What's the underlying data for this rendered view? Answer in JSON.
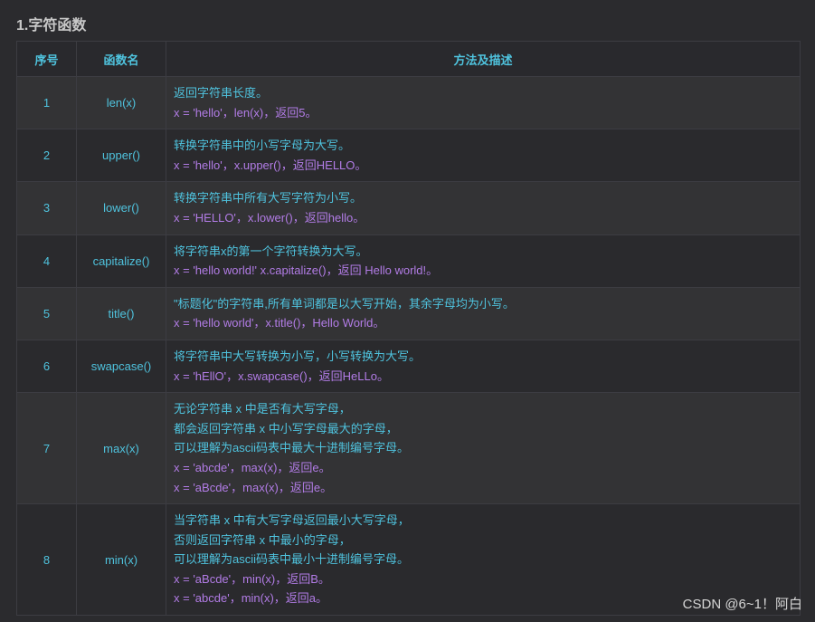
{
  "heading": "1.字符函数",
  "headers": {
    "num": "序号",
    "name": "函数名",
    "desc": "方法及描述"
  },
  "rows": [
    {
      "num": "1",
      "name": "len(x)",
      "lines": [
        "返回字符串长度。"
      ],
      "examples": [
        "x = 'hello'，len(x)，返回5。"
      ]
    },
    {
      "num": "2",
      "name": "upper()",
      "lines": [
        "转换字符串中的小写字母为大写。"
      ],
      "examples": [
        "x = 'hello'，x.upper()，返回HELLO。"
      ]
    },
    {
      "num": "3",
      "name": "lower()",
      "lines": [
        "转换字符串中所有大写字符为小写。"
      ],
      "examples": [
        "x = 'HELLO'，x.lower()，返回hello。"
      ]
    },
    {
      "num": "4",
      "name": "capitalize()",
      "lines": [
        "将字符串x的第一个字符转换为大写。"
      ],
      "examples": [
        "x = 'hello world!' x.capitalize()，返回 Hello world!。"
      ]
    },
    {
      "num": "5",
      "name": "title()",
      "lines": [
        "\"标题化\"的字符串,所有单词都是以大写开始，其余字母均为小写。"
      ],
      "examples": [
        "x = 'hello world'，x.title()，Hello World。"
      ]
    },
    {
      "num": "6",
      "name": "swapcase()",
      "lines": [
        "将字符串中大写转换为小写，小写转换为大写。"
      ],
      "examples": [
        "x = 'hEllO'，x.swapcase()，返回HeLLo。"
      ]
    },
    {
      "num": "7",
      "name": "max(x)",
      "lines": [
        "无论字符串 x 中是否有大写字母，",
        "都会返回字符串 x 中小写字母最大的字母，",
        "可以理解为ascii码表中最大十进制编号字母。"
      ],
      "examples": [
        "x = 'abcde'，max(x)，返回e。",
        "x = 'aBcde'，max(x)，返回e。"
      ]
    },
    {
      "num": "8",
      "name": "min(x)",
      "lines": [
        "当字符串 x 中有大写字母返回最小大写字母，",
        "否则返回字符串 x 中最小的字母，",
        "可以理解为ascii码表中最小十进制编号字母。"
      ],
      "examples": [
        "x = 'aBcde'，min(x)，返回B。",
        "x = 'abcde'，min(x)，返回a。"
      ]
    }
  ],
  "watermark": "CSDN @6~1！阿白"
}
